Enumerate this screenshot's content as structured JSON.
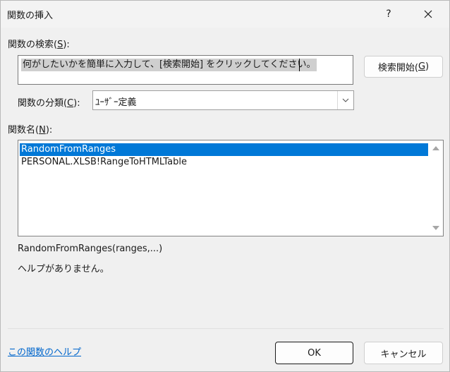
{
  "window": {
    "title": "関数の挿入",
    "help_glyph": "?",
    "close_glyph": "✕"
  },
  "search": {
    "label_prefix": "関数の検索(",
    "label_key": "S",
    "label_suffix": "):",
    "value": "何がしたいかを簡単に入力して、[検索開始] をクリックしてください。",
    "button_prefix": "検索開始(",
    "button_key": "G",
    "button_suffix": ")"
  },
  "category": {
    "label_prefix": "関数の分類(",
    "label_key": "C",
    "label_suffix": "):",
    "selected": "ﾕｰｻﾞｰ定義"
  },
  "function_list": {
    "label_prefix": "関数名(",
    "label_key": "N",
    "label_suffix": "):",
    "items": [
      {
        "label": "RandomFromRanges",
        "selected": true
      },
      {
        "label": "PERSONAL.XLSB!RangeToHTMLTable",
        "selected": false
      }
    ]
  },
  "details": {
    "signature": "RandomFromRanges(ranges,...)",
    "description": "ヘルプがありません。"
  },
  "footer": {
    "help_link": "この関数のヘルプ",
    "ok_label": "OK",
    "cancel_label": "キャンセル"
  },
  "colors": {
    "selection": "#0078d7",
    "link": "#0066cc",
    "background": "#f0f0f0"
  }
}
